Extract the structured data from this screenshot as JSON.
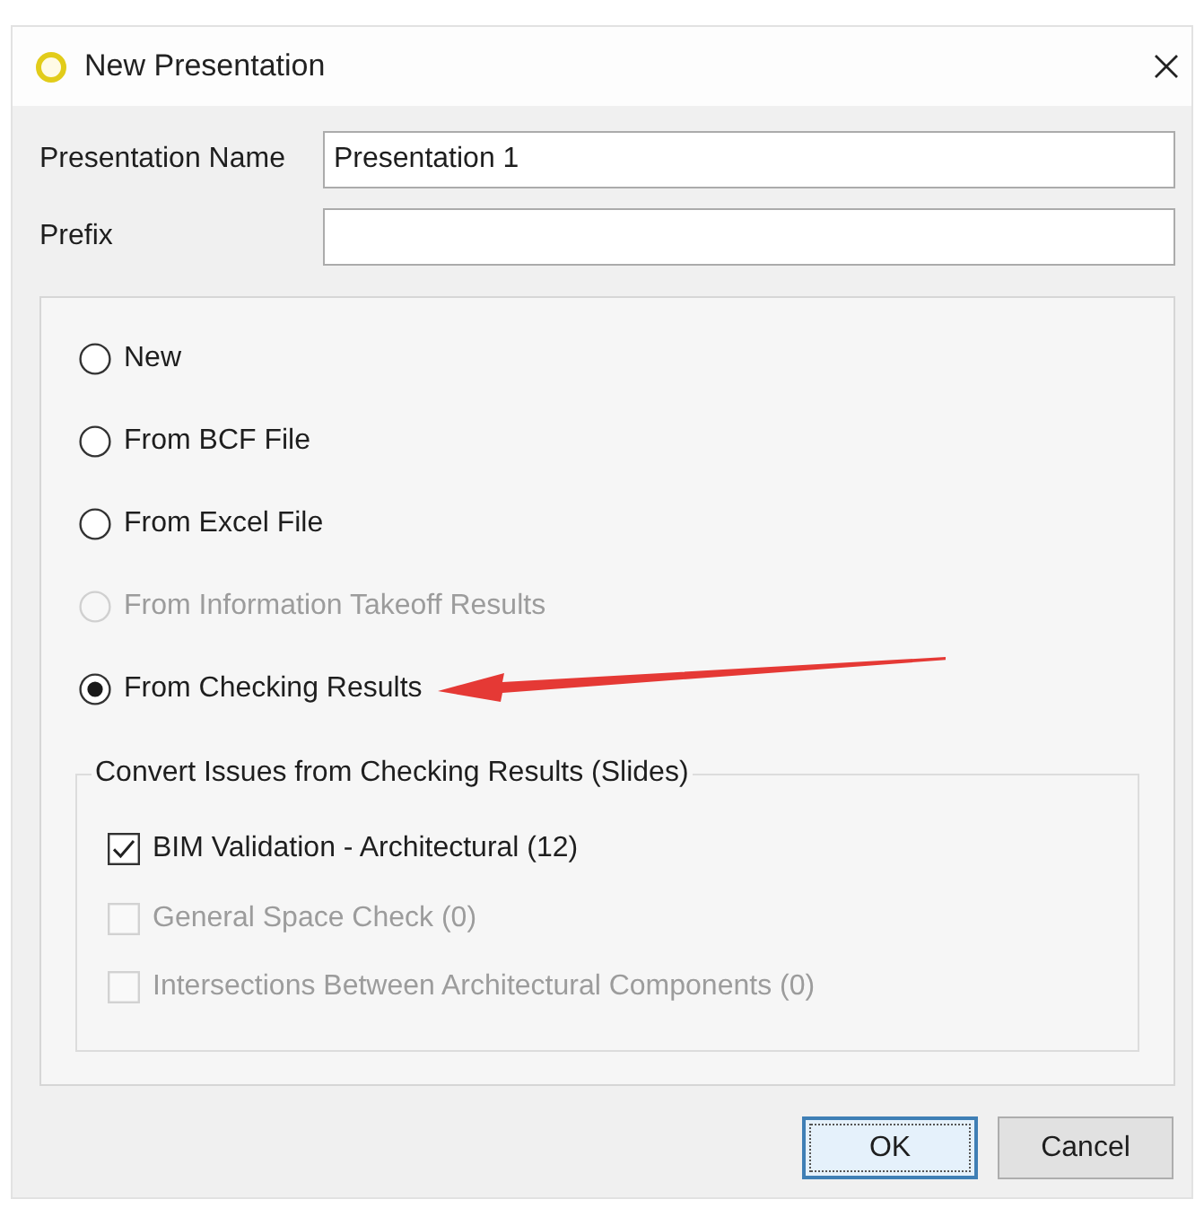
{
  "window": {
    "title": "New Presentation"
  },
  "fields": [
    {
      "label": "Presentation Name",
      "value": "Presentation 1"
    },
    {
      "label": "Prefix"
    }
  ],
  "source_options": [
    {
      "label": "New",
      "selected": false,
      "disabled": false,
      "pointed_at": false
    },
    {
      "label": "From BCF File",
      "selected": false,
      "disabled": false,
      "pointed_at": false
    },
    {
      "label": "From Excel File",
      "selected": false,
      "disabled": false,
      "pointed_at": false
    },
    {
      "label": "From Information Takeoff Results",
      "selected": false,
      "disabled": true,
      "pointed_at": false
    },
    {
      "label": "From Checking Results",
      "selected": true,
      "disabled": false,
      "pointed_at": true
    }
  ],
  "checking_group": {
    "title": "Convert Issues from Checking Results (Slides)",
    "items": [
      {
        "label": "BIM Validation - Architectural (12)",
        "checked": true,
        "disabled": false
      },
      {
        "label": "General Space Check (0)",
        "checked": false,
        "disabled": true
      },
      {
        "label": "Intersections Between Architectural Components (0)",
        "checked": false,
        "disabled": true
      }
    ]
  },
  "buttons": [
    {
      "label": "OK",
      "focused": true
    },
    {
      "label": "Cancel",
      "focused": false
    }
  ]
}
